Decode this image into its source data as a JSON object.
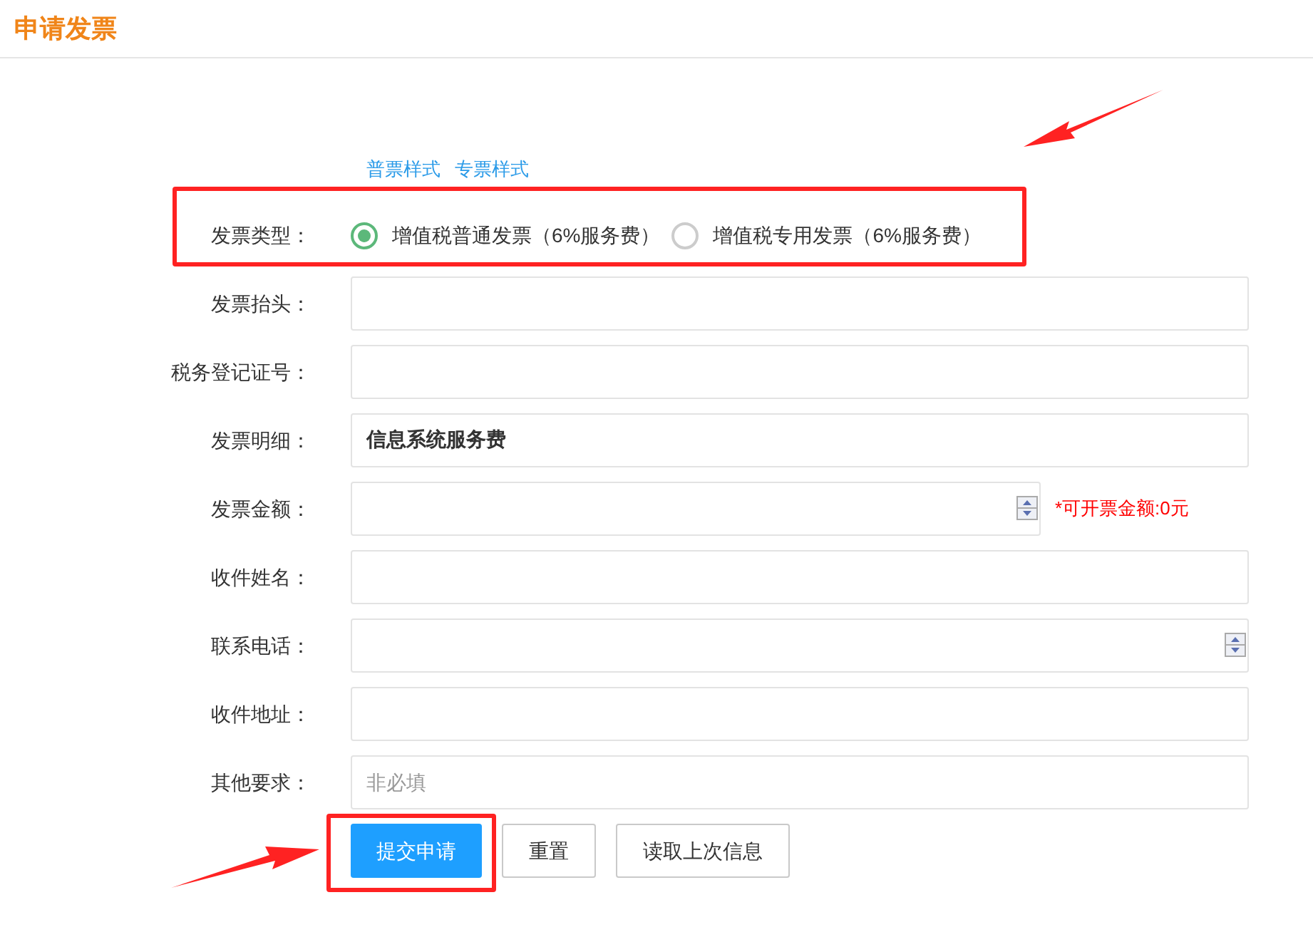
{
  "title": "申请发票",
  "sample_links": [
    "普票样式",
    "专票样式"
  ],
  "invoice_type": {
    "label": "发票类型：",
    "options": [
      {
        "label": "增值税普通发票（6%服务费）",
        "selected": true
      },
      {
        "label": "增值税专用发票（6%服务费）",
        "selected": false
      }
    ]
  },
  "fields": [
    {
      "label": "发票抬头：",
      "kind": "text"
    },
    {
      "label": "税务登记证号：",
      "kind": "text"
    },
    {
      "label": "发票明细：",
      "kind": "text",
      "value": "信息系统服务费"
    },
    {
      "label": "发票金额：",
      "kind": "number",
      "note": "*可开票金额:0元"
    },
    {
      "label": "收件姓名：",
      "kind": "text"
    },
    {
      "label": "联系电话：",
      "kind": "number"
    },
    {
      "label": "收件地址：",
      "kind": "text"
    },
    {
      "label": "其他要求：",
      "kind": "text",
      "placeholder": "非必填"
    }
  ],
  "buttons": [
    {
      "label": "提交申请",
      "kind": "primary"
    },
    {
      "label": "重置",
      "kind": "default"
    },
    {
      "label": "读取上次信息",
      "kind": "default"
    }
  ]
}
